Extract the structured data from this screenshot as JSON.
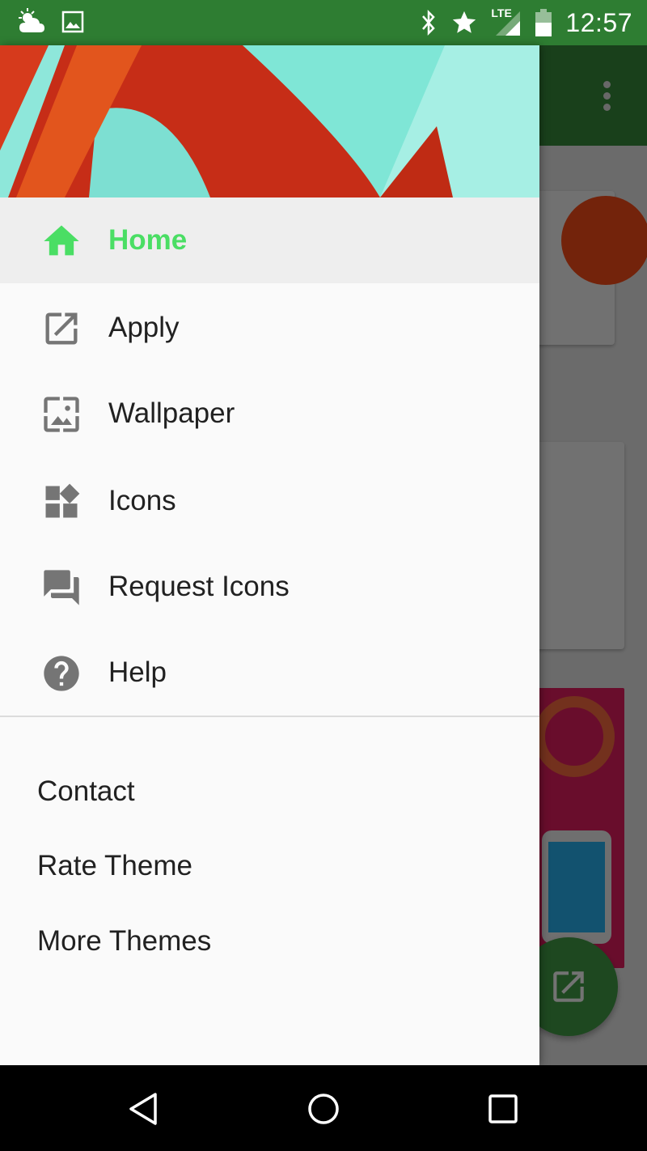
{
  "status_bar": {
    "time": "12:57",
    "network": "LTE",
    "left_icons": [
      "weather-cloudy-icon",
      "image-notification-icon"
    ],
    "right_icons": [
      "bluetooth-icon",
      "star-icon",
      "lte-signal-icon",
      "battery-icon"
    ]
  },
  "drawer": {
    "primary_items": [
      {
        "label": "Home",
        "icon": "home-icon",
        "selected": true
      },
      {
        "label": "Apply",
        "icon": "open-external-icon",
        "selected": false
      },
      {
        "label": "Wallpaper",
        "icon": "wallpaper-icon",
        "selected": false
      },
      {
        "label": "Icons",
        "icon": "widgets-icon",
        "selected": false
      },
      {
        "label": "Request Icons",
        "icon": "forum-icon",
        "selected": false
      },
      {
        "label": "Help",
        "icon": "help-icon",
        "selected": false
      }
    ],
    "secondary_items": [
      {
        "label": "Contact"
      },
      {
        "label": "Rate Theme"
      },
      {
        "label": "More Themes"
      }
    ]
  },
  "colors": {
    "status_bar": "#2e7d32",
    "toolbar": "#388e3c",
    "accent": "#4ade64",
    "text_primary": "#212121",
    "icon_gray": "#757575"
  },
  "system_nav": {
    "buttons": [
      "back-icon",
      "home-circle-icon",
      "recents-icon"
    ]
  }
}
